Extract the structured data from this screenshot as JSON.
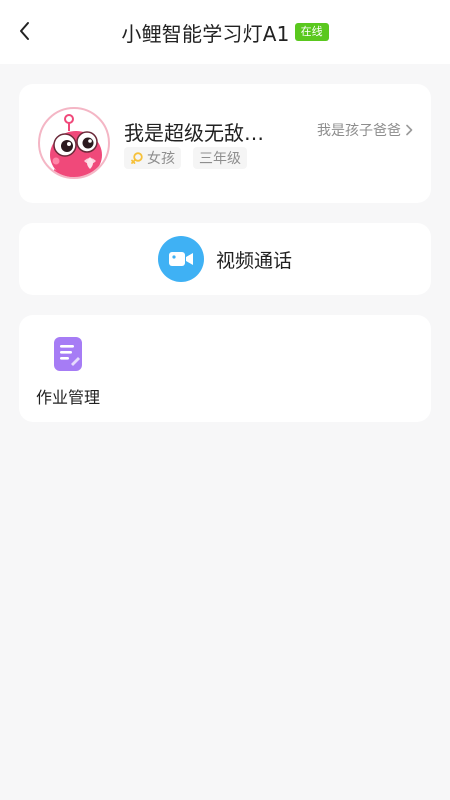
{
  "header": {
    "title": "小鲤智能学习灯A1",
    "status": "在线"
  },
  "profile": {
    "nickname": "我是超级无敌…",
    "relation": "我是孩子爸爸",
    "gender": "女孩",
    "grade": "三年级"
  },
  "video_call": {
    "label": "视频通话"
  },
  "tools": [
    {
      "label": "作业管理",
      "icon": "homework-icon"
    }
  ],
  "colors": {
    "status_badge": "#5ac81e",
    "video_icon_bg": "#3fb1f4",
    "homework_icon": "#a67cf5",
    "background": "#f7f7f8"
  }
}
